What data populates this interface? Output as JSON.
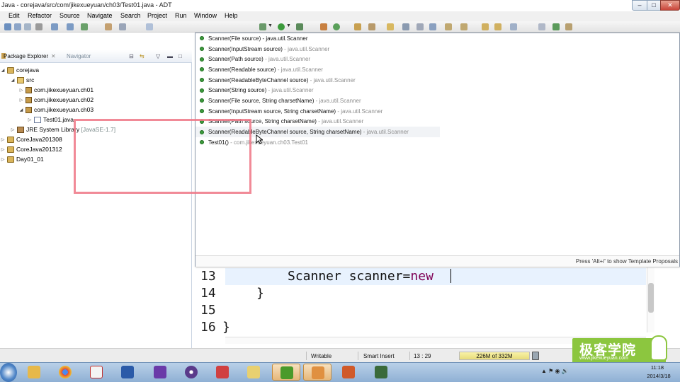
{
  "window": {
    "title": "Java - corejava/src/com/jikexueyuan/ch03/Test01.java - ADT",
    "controls": {
      "minimize": "‒",
      "maximize": "□",
      "close": "✕"
    }
  },
  "menu": [
    "Edit",
    "Refactor",
    "Source",
    "Navigate",
    "Search",
    "Project",
    "Run",
    "Window",
    "Help"
  ],
  "left_panel": {
    "tabs": {
      "active": "Package Explorer",
      "inactive": "Navigator"
    },
    "tree": [
      {
        "label": "corejava",
        "level": 0,
        "expanded": true,
        "icon": "project-icon"
      },
      {
        "label": "src",
        "level": 1,
        "expanded": true,
        "icon": "source-folder-icon"
      },
      {
        "label": "com.jikexueyuan.ch01",
        "level": 2,
        "expanded": false,
        "icon": "package-icon"
      },
      {
        "label": "com.jikexueyuan.ch02",
        "level": 2,
        "expanded": false,
        "icon": "package-icon"
      },
      {
        "label": "com.jikexueyuan.ch03",
        "level": 2,
        "expanded": true,
        "icon": "package-icon"
      },
      {
        "label": "Test01.java",
        "level": 3,
        "expanded": false,
        "icon": "java-file-icon"
      },
      {
        "label": "JRE System Library",
        "suffix": "[JavaSE-1.7]",
        "level": 1,
        "expanded": false,
        "icon": "library-icon"
      },
      {
        "label": "CoreJava201308",
        "level": 0,
        "expanded": false,
        "icon": "project-icon"
      },
      {
        "label": "CoreJava201312",
        "level": 0,
        "expanded": false,
        "icon": "project-icon"
      },
      {
        "label": "Day01_01",
        "level": 0,
        "expanded": false,
        "icon": "project-icon"
      }
    ]
  },
  "content_assist": {
    "proposals": [
      {
        "sig": "Scanner(File source)",
        "qual": "java.util.Scanner"
      },
      {
        "sig": "Scanner(InputStream source)",
        "qual": "java.util.Scanner"
      },
      {
        "sig": "Scanner(Path source)",
        "qual": "java.util.Scanner"
      },
      {
        "sig": "Scanner(Readable source)",
        "qual": "java.util.Scanner"
      },
      {
        "sig": "Scanner(ReadableByteChannel source)",
        "qual": "java.util.Scanner"
      },
      {
        "sig": "Scanner(String source)",
        "qual": "java.util.Scanner"
      },
      {
        "sig": "Scanner(File source, String charsetName)",
        "qual": "java.util.Scanner"
      },
      {
        "sig": "Scanner(InputStream source, String charsetName)",
        "qual": "java.util.Scanner"
      },
      {
        "sig": "Scanner(Path source, String charsetName)",
        "qual": "java.util.Scanner"
      },
      {
        "sig": "Scanner(ReadableByteChannel source, String charsetName)",
        "qual": "java.util.Scanner"
      },
      {
        "sig": "Test01()",
        "qual": "com.jikexueyuan.ch03.Test01"
      }
    ],
    "status": "Press 'Alt+/' to show Template Proposals"
  },
  "editor": {
    "lines": [
      {
        "num": "13",
        "code": "Scanner scanner=",
        "keyword": "new"
      },
      {
        "num": "14",
        "code": "}",
        "keyword": ""
      },
      {
        "num": "15",
        "code": "",
        "keyword": ""
      },
      {
        "num": "16",
        "code": "}",
        "keyword": ""
      }
    ]
  },
  "status_bar": {
    "mode": "Writable",
    "insert": "Smart Insert",
    "position": "13 : 29",
    "heap": "226M of 332M"
  },
  "watermark": {
    "name": "极客学院",
    "url": "www.jikexueyuan.com"
  },
  "taskbar": {
    "apps": [
      "windows-explorer",
      "chrome",
      "acrobat",
      "word",
      "visual-studio",
      "eclipse",
      "file-manager",
      "file-folder",
      "json-editor",
      "people",
      "powerpoint",
      "dreamweaver"
    ],
    "clock_time": "11:18",
    "clock_date": "2014/3/18"
  }
}
